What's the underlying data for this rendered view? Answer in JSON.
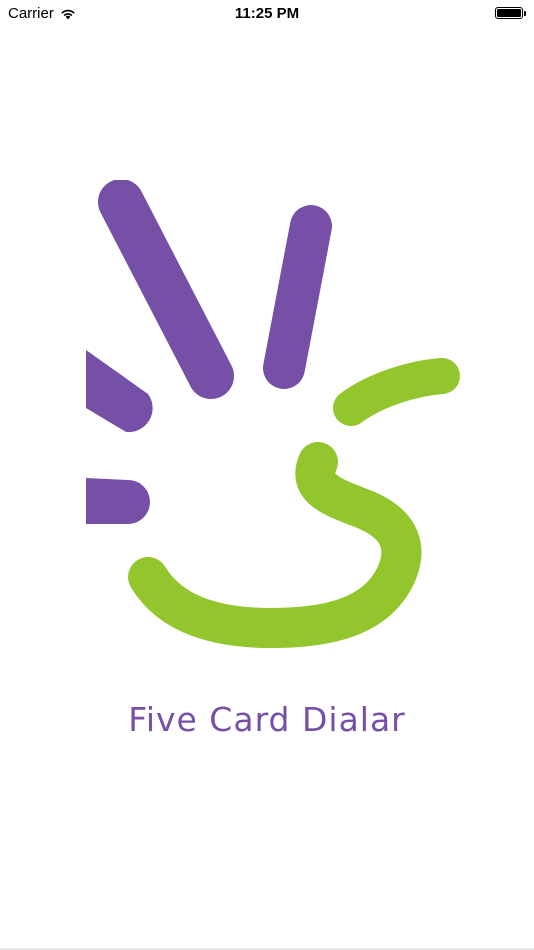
{
  "status_bar": {
    "carrier": "Carrier",
    "time": "11:25 PM",
    "wifi_icon": "wifi-icon",
    "battery_icon": "battery-full-icon"
  },
  "splash": {
    "logo_icon": "hand-smile-logo",
    "title": "Five Card Dialar"
  },
  "colors": {
    "purple": "#7550a6",
    "green": "#93c62c",
    "background": "#ffffff"
  }
}
